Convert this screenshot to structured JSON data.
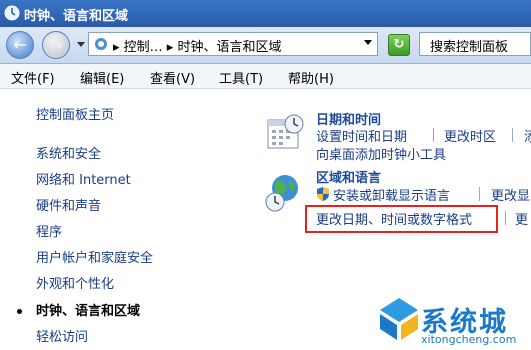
{
  "window": {
    "title": "时钟、语言和区域"
  },
  "navbar": {
    "back_label": "←",
    "forward_label": "→",
    "address": "▸ 控制… ▸ 时钟、语言和区域",
    "refresh_label": "↻",
    "search_placeholder": "搜索控制面板"
  },
  "menu": [
    "文件(F)",
    "编辑(E)",
    "查看(V)",
    "工具(T)",
    "帮助(H)"
  ],
  "sidebar": {
    "home": "控制面板主页",
    "items": [
      "系统和安全",
      "网络和 Internet",
      "硬件和声音",
      "程序",
      "用户帐户和家庭安全",
      "外观和个性化",
      "时钟、语言和区域",
      "轻松访问"
    ],
    "current_index": 6
  },
  "categories": {
    "datetime": {
      "title": "日期和时间",
      "links": [
        "设置时间和日期",
        "更改时区",
        "添",
        "向桌面添加时钟小工具"
      ]
    },
    "region": {
      "title": "区域和语言",
      "links": [
        "安装或卸载显示语言",
        "更改显",
        "更改日期、时间或数字格式",
        "更"
      ]
    }
  },
  "watermark": {
    "text": "系统城",
    "sub": "xitongcheng.com"
  },
  "colors": {
    "highlight": "#e8211d",
    "link": "#1a3c88",
    "title_bar": "#2a5aa9"
  }
}
